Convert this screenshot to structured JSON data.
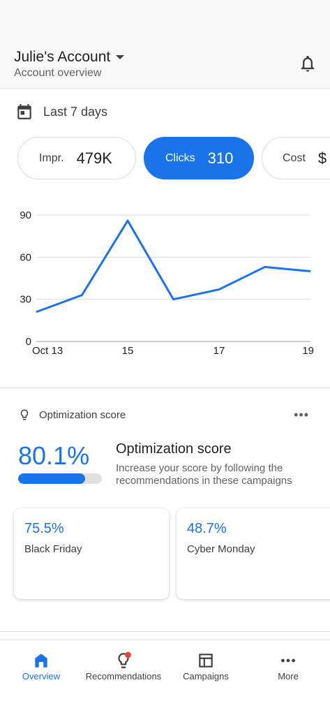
{
  "header": {
    "account_name": "Julie's Account",
    "subtitle": "Account overview",
    "notifications_icon": "bell-icon"
  },
  "date_range": {
    "icon": "calendar-icon",
    "label": "Last 7 days"
  },
  "metrics": [
    {
      "label": "Impr.",
      "value": "479K",
      "active": false
    },
    {
      "label": "Clicks",
      "value": "310",
      "active": true
    },
    {
      "label": "Cost",
      "value": "$",
      "active": false
    }
  ],
  "chart_data": {
    "type": "line",
    "x": [
      "Oct 13",
      "14",
      "15",
      "16",
      "17",
      "18",
      "19"
    ],
    "xtick_labels": [
      "Oct 13",
      "",
      "15",
      "",
      "17",
      "",
      "19"
    ],
    "series": [
      {
        "values": [
          21,
          33,
          86,
          30,
          37,
          53,
          50
        ]
      }
    ],
    "ylim": [
      0,
      90
    ],
    "yticks": [
      "0",
      "30",
      "60",
      "90"
    ],
    "grid": true,
    "color": "#1a73e8"
  },
  "optimization": {
    "header_icon": "lightbulb-icon",
    "header_label": "Optimization score",
    "menu_icon": "more-horiz-icon",
    "score": "80.1%",
    "score_fraction": 0.801,
    "title": "Optimization score",
    "description": "Increase your score by following the recommendations in these campaigns",
    "campaigns": [
      {
        "score": "75.5%",
        "name": "Black Friday"
      },
      {
        "score": "48.7%",
        "name": "Cyber Monday"
      }
    ]
  },
  "bottom_nav": [
    {
      "label": "Overview",
      "icon": "home-icon",
      "active": true
    },
    {
      "label": "Recommendations",
      "icon": "lightbulb-icon",
      "active": false,
      "badge": true
    },
    {
      "label": "Campaigns",
      "icon": "campaigns-icon",
      "active": false
    },
    {
      "label": "More",
      "icon": "more-horiz-icon",
      "active": false
    }
  ],
  "colors": {
    "accent": "#1a73e8",
    "badge": "#ea4335"
  }
}
